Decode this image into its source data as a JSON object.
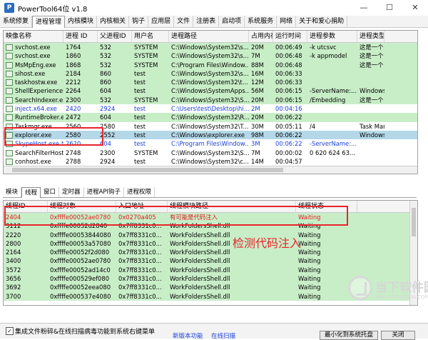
{
  "window": {
    "title": "PowerTool64位 v1.8",
    "app_icon": "P",
    "min": "—",
    "max": "☐",
    "close": "✕"
  },
  "menu_tabs": [
    "系统修复",
    "进程管理",
    "内核模块",
    "内核相关",
    "钩子",
    "应用层",
    "文件",
    "注册表",
    "启动项",
    "系统服务",
    "网络",
    "关于和爱心捐助"
  ],
  "menu_active_index": 1,
  "process_table": {
    "columns": [
      "映像名称",
      "进程 ID",
      "父进程ID",
      "用户名",
      "进程路径",
      "占用内存",
      "运行时间",
      "进程参数",
      "进程类型"
    ],
    "rows": [
      {
        "c": [
          "svchost.exe",
          "1764",
          "532",
          "SYSTEM",
          "C:\\Windows\\System32\\s...",
          "20M",
          "00:06:49",
          "-k utcsvc",
          "这是一个"
        ],
        "style": "green"
      },
      {
        "c": [
          "svchost.exe",
          "1860",
          "532",
          "SYSTEM",
          "C:\\Windows\\System32\\s...",
          "7M",
          "00:06:48",
          "-k appmodel",
          "这是一个"
        ],
        "style": "green"
      },
      {
        "c": [
          "MsMpEng.exe",
          "1868",
          "532",
          "SYSTEM",
          "C:\\Program Files\\Window...",
          "88M",
          "00:06:48",
          "",
          "这是一个"
        ],
        "style": "green"
      },
      {
        "c": [
          "sihost.exe",
          "2184",
          "860",
          "test",
          "C:\\Windows\\System32\\s...",
          "16M",
          "00:06:33",
          "",
          ""
        ],
        "style": "green"
      },
      {
        "c": [
          "taskhostw.exe",
          "2212",
          "860",
          "test",
          "C:\\Windows\\System32\\t...",
          "12M",
          "00:06:33",
          "",
          ""
        ],
        "style": "green"
      },
      {
        "c": [
          "ShellExperienceH...",
          "2264",
          "604",
          "test",
          "C:\\Windows\\SystemApps...",
          "56M",
          "00:06:15",
          "-ServerName:...",
          "Windows"
        ],
        "style": "green"
      },
      {
        "c": [
          "SearchIndexer.exe",
          "2300",
          "532",
          "SYSTEM",
          "C:\\Windows\\System32\\S...",
          "20M",
          "00:06:15",
          "/Embedding",
          "这是一个"
        ],
        "style": "green"
      },
      {
        "c": [
          "inject.x64.exe",
          "2420",
          "2924",
          "test",
          "C:\\Users\\test\\Desktop\\hi...",
          "2M",
          "00:04:16",
          "",
          ""
        ],
        "style": "blue"
      },
      {
        "c": [
          "RuntimeBroker.exe",
          "2472",
          "604",
          "test",
          "C:\\Windows\\System32\\R...",
          "20M",
          "00:06:22",
          "",
          ""
        ],
        "style": "green"
      },
      {
        "c": [
          "Taskmgr.exe",
          "2560",
          "2580",
          "test",
          "C:\\Windows\\System32\\T...",
          "30M",
          "00:05:11",
          "/4",
          "Task Man"
        ],
        "style": "white"
      },
      {
        "c": [
          "explorer.exe",
          "2580",
          "2552",
          "test",
          "C:\\Windows\\explorer.exe",
          "98M",
          "00:06:22",
          "",
          "Windows"
        ],
        "style": "sel"
      },
      {
        "c": [
          "SkypeHost.exe *32",
          "2620",
          "604",
          "test",
          "C:\\Program Files\\Window...",
          "3M",
          "00:06:22",
          "-ServerName:...",
          ""
        ],
        "style": "blue"
      },
      {
        "c": [
          "SearchFilterHost.ex...",
          "2748",
          "2300",
          "SYSTEM",
          "C:\\Windows\\System32\\S...",
          "7M",
          "00:00:02",
          "0 620 624 63...",
          ""
        ],
        "style": "white"
      },
      {
        "c": [
          "conhost.exe",
          "2788",
          "2924",
          "test",
          "C:\\Windows\\System32\\c...",
          "14M",
          "00:04:57",
          "",
          ""
        ],
        "style": "white"
      }
    ]
  },
  "bottom_tabs": [
    "模块",
    "线程",
    "窗口",
    "定时器",
    "进程API钩子",
    "进程权限"
  ],
  "bottom_active_index": 1,
  "thread_table": {
    "columns": [
      "线程ID",
      "线程对象",
      "入口地址",
      "线程模块路径",
      "线程状态"
    ],
    "rows": [
      {
        "c": [
          "2404",
          "0xffffe00052ae0780",
          "0x0270a405",
          "有可能是代码注入",
          "Waiting"
        ],
        "style": "red"
      },
      {
        "c": [
          "3112",
          "0xffffe00052d2840",
          "0x7ff8331c0...",
          "WorkFoldersShell.dll",
          "Waiting"
        ],
        "style": "green"
      },
      {
        "c": [
          "2220",
          "0xffffe00053844080",
          "0x7ff8331c0...",
          "WorkFoldersShell.dll",
          "Waiting"
        ],
        "style": "green"
      },
      {
        "c": [
          "2800",
          "0xffffe00053a57080",
          "0x7ff8331c0...",
          "WorkFoldersShell.dll",
          "Waiting"
        ],
        "style": "green"
      },
      {
        "c": [
          "2164",
          "0xffffe00052f2d080",
          "0x7ff8331c0...",
          "WorkFoldersShell.dll",
          "Waiting"
        ],
        "style": "green"
      },
      {
        "c": [
          "3400",
          "0xffffe00052ae0780",
          "0x7ff8331c0...",
          "WorkFoldersShell.dll",
          "Waiting"
        ],
        "style": "green"
      },
      {
        "c": [
          "3572",
          "0xffffe00052ad14c0",
          "0x7ff8331c0...",
          "WorkFoldersShell.dll",
          "Waiting"
        ],
        "style": "green"
      },
      {
        "c": [
          "3656",
          "0xffffe000529ef080",
          "0x7ff8331c0...",
          "WorkFoldersShell.dll",
          "Waiting"
        ],
        "style": "green"
      },
      {
        "c": [
          "3692",
          "0xffffe00052eea080",
          "0x7ff8331c0...",
          "WorkFoldersShell.dll",
          "Waiting"
        ],
        "style": "green"
      },
      {
        "c": [
          "3700",
          "0xffffe000537e4080",
          "0x7ff8331c0...",
          "WorkFoldersShell.dll",
          "Waiting"
        ],
        "style": "green"
      }
    ]
  },
  "annotation": "检测代码注入",
  "bottom_bar": {
    "checkbox_checked": "✓",
    "checkbox_label": "集成文件粉碎&在线扫描病毒功能到系统右键菜单",
    "link1": "新版本功能",
    "link2": "在线扫描",
    "btn_hide": "最小化到系统托盘",
    "btn_close": "关闭"
  },
  "watermark": {
    "big": "当下软件园",
    "small": "WWW.DOWNXIA.COM"
  }
}
